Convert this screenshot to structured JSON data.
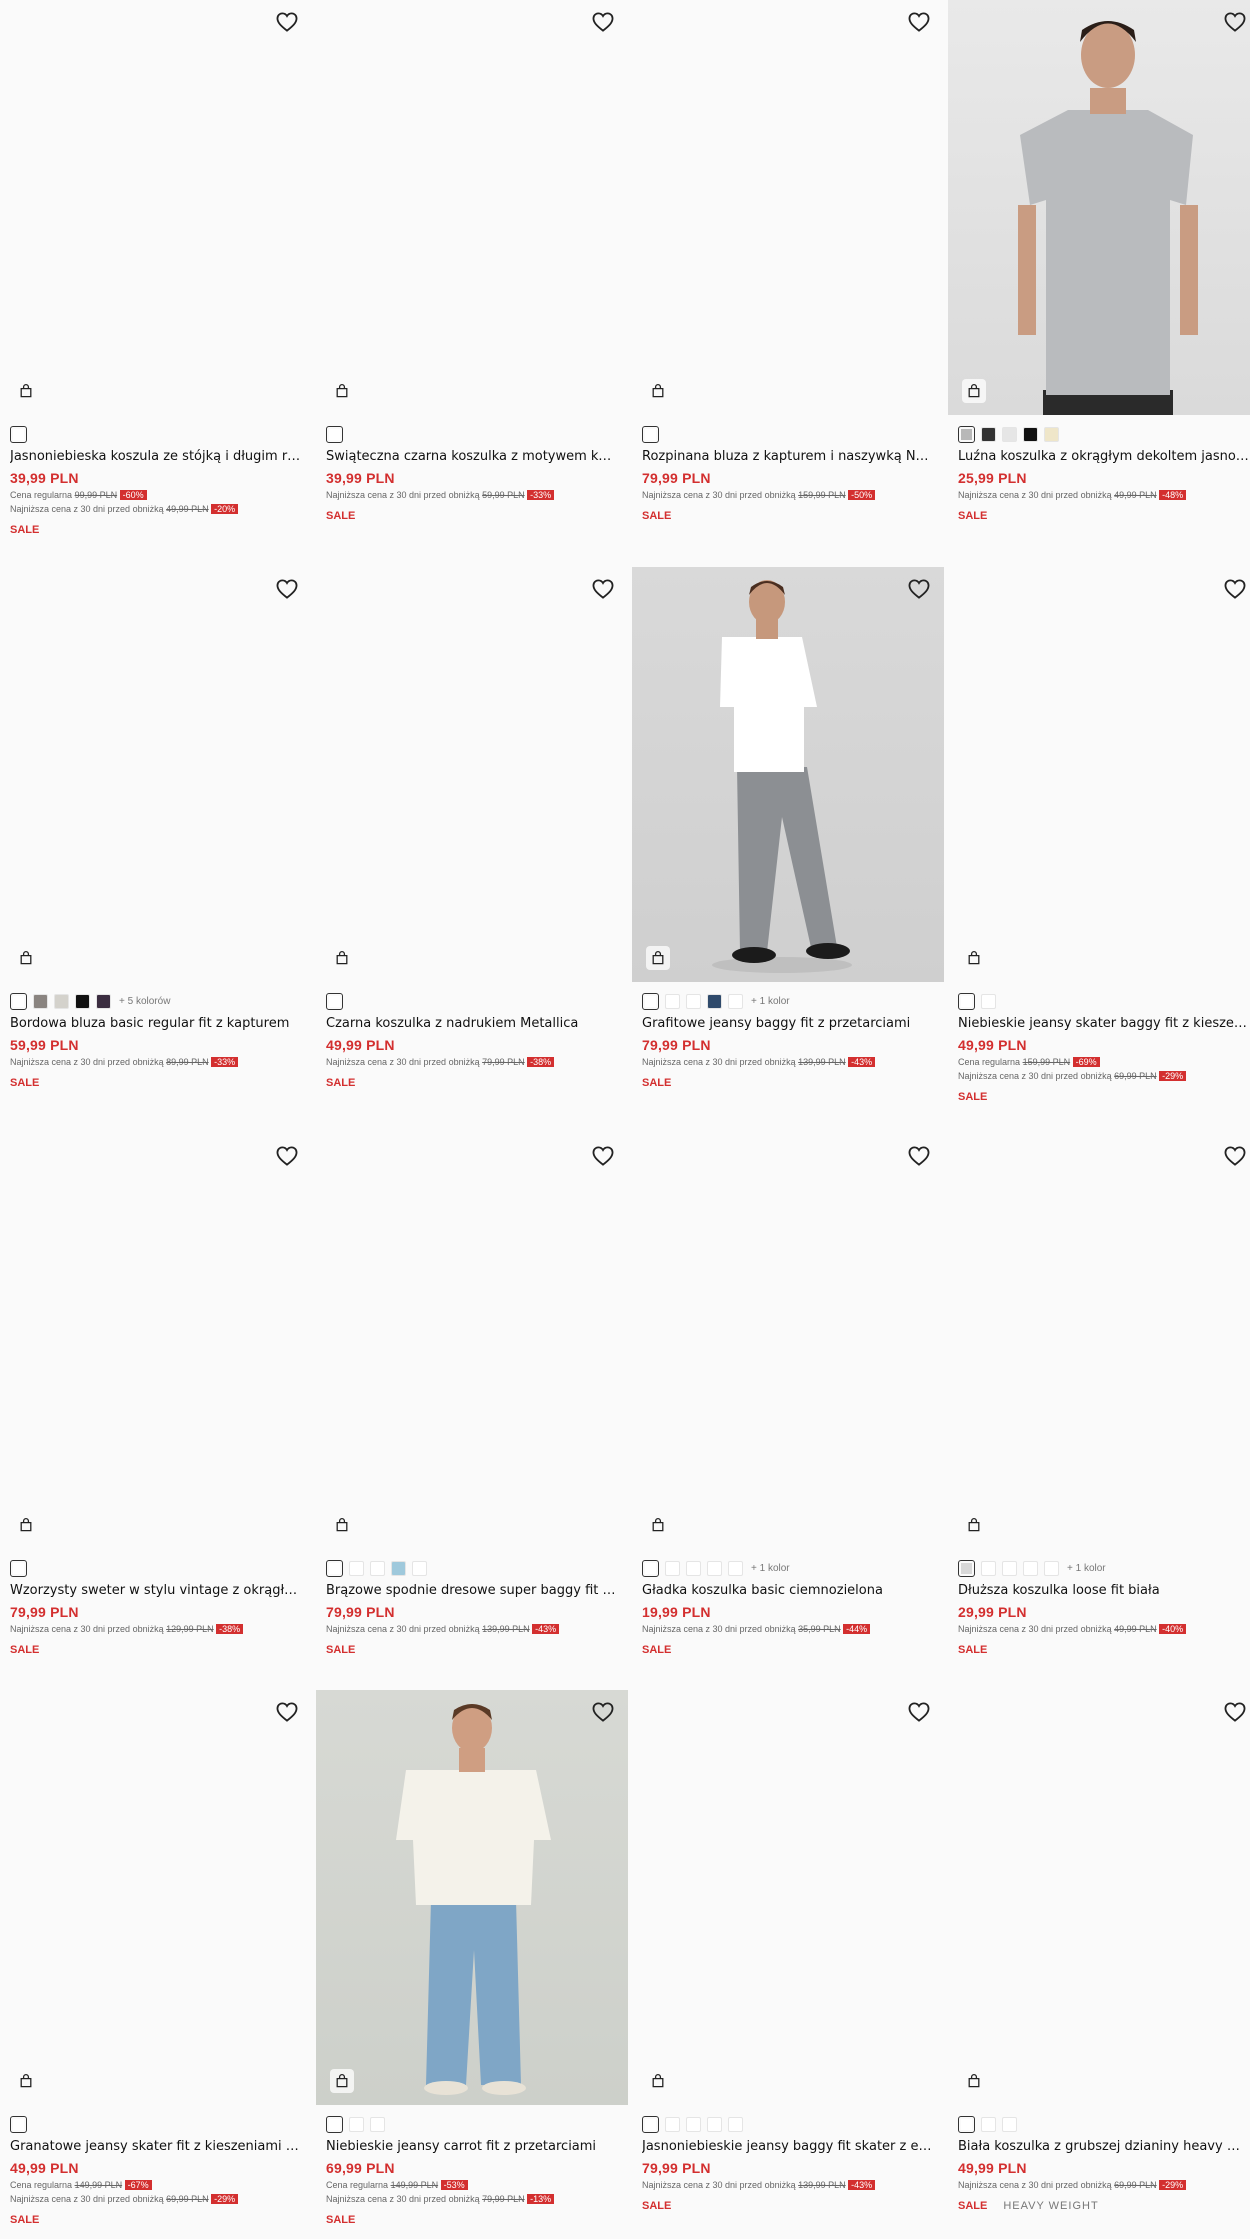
{
  "icons": {
    "wishlist": "heart-icon",
    "cart": "shopping-bag-icon"
  },
  "colors": {
    "price": "#d32f2f",
    "discount_bg": "#d32f2f",
    "background": "#fafafa"
  },
  "products": [
    {
      "name": "Jasnoniebieska koszula ze stójką i długim rękawem",
      "price": "39,99 PLN",
      "lines": [
        {
          "label": "Cena regularna",
          "old": "99,99 PLN",
          "disc": "-60%"
        },
        {
          "label": "Najniższa cena z 30 dni przed obniżką",
          "old": "49,99 PLN",
          "disc": "-20%"
        }
      ],
      "tags": [
        "SALE"
      ],
      "swatches": [
        {
          "color": "#ffffff",
          "selected": true
        }
      ],
      "more": ""
    },
    {
      "name": "Świąteczna czarna koszulka z motywem karmy",
      "price": "39,99 PLN",
      "lines": [
        {
          "label": "Najniższa cena z 30 dni przed obniżką",
          "old": "59,99 PLN",
          "disc": "-33%"
        }
      ],
      "tags": [
        "SALE"
      ],
      "swatches": [
        {
          "color": "#ffffff",
          "selected": true
        }
      ],
      "more": ""
    },
    {
      "name": "Rozpinana bluza z kapturem i naszywką NY granatowa",
      "price": "79,99 PLN",
      "lines": [
        {
          "label": "Najniższa cena z 30 dni przed obniżką",
          "old": "159,99 PLN",
          "disc": "-50%"
        }
      ],
      "tags": [
        "SALE"
      ],
      "swatches": [
        {
          "color": "#ffffff",
          "selected": true
        }
      ],
      "more": ""
    },
    {
      "name": "Luźna koszulka z okrągłym dekoltem jasnoszara melanż",
      "price": "25,99 PLN",
      "lines": [
        {
          "label": "Najniższa cena z 30 dni przed obniżką",
          "old": "49,99 PLN",
          "disc": "-48%"
        }
      ],
      "tags": [
        "SALE"
      ],
      "swatches": [
        {
          "color": "#b8b8b8",
          "selected": true
        },
        {
          "color": "#333333"
        },
        {
          "color": "#e6e6e6"
        },
        {
          "color": "#111111"
        },
        {
          "color": "#efe6c9"
        }
      ],
      "more": ""
    },
    {
      "name": "Bordowa bluza basic regular fit z kapturem",
      "price": "59,99 PLN",
      "lines": [
        {
          "label": "Najniższa cena z 30 dni przed obniżką",
          "old": "89,99 PLN",
          "disc": "-33%"
        }
      ],
      "tags": [
        "SALE"
      ],
      "swatches": [
        {
          "color": "#ffffff",
          "selected": true
        },
        {
          "color": "#8a8480"
        },
        {
          "color": "#d4d2cc"
        },
        {
          "color": "#111111"
        },
        {
          "color": "#3b2d40"
        }
      ],
      "more": "+ 5 kolorów"
    },
    {
      "name": "Czarna koszulka z nadrukiem Metallica",
      "price": "49,99 PLN",
      "lines": [
        {
          "label": "Najniższa cena z 30 dni przed obniżką",
          "old": "79,99 PLN",
          "disc": "-38%"
        }
      ],
      "tags": [
        "SALE"
      ],
      "swatches": [
        {
          "color": "#ffffff",
          "selected": true
        }
      ],
      "more": ""
    },
    {
      "name": "Grafitowe jeansy baggy fit z przetarciami",
      "price": "79,99 PLN",
      "lines": [
        {
          "label": "Najniższa cena z 30 dni przed obniżką",
          "old": "139,99 PLN",
          "disc": "-43%"
        }
      ],
      "tags": [
        "SALE"
      ],
      "swatches": [
        {
          "color": "#ffffff",
          "selected": true
        },
        {
          "color": "#ffffff"
        },
        {
          "color": "#ffffff"
        },
        {
          "color": "#2f4a6b"
        },
        {
          "color": "#ffffff"
        }
      ],
      "more": "+ 1 kolor"
    },
    {
      "name": "Niebieskie jeansy skater baggy fit z kieszeniami cargo",
      "price": "49,99 PLN",
      "lines": [
        {
          "label": "Cena regularna",
          "old": "159,99 PLN",
          "disc": "-69%"
        },
        {
          "label": "Najniższa cena z 30 dni przed obniżką",
          "old": "69,99 PLN",
          "disc": "-29%"
        }
      ],
      "tags": [
        "SALE"
      ],
      "swatches": [
        {
          "color": "#ffffff",
          "selected": true
        },
        {
          "color": "#ffffff"
        }
      ],
      "more": ""
    },
    {
      "name": "Wzorzysty sweter w stylu vintage z okrągłym dekoltem",
      "price": "79,99 PLN",
      "lines": [
        {
          "label": "Najniższa cena z 30 dni przed obniżką",
          "old": "129,99 PLN",
          "disc": "-38%"
        }
      ],
      "tags": [
        "SALE"
      ],
      "swatches": [
        {
          "color": "#ffffff",
          "selected": true
        }
      ],
      "more": ""
    },
    {
      "name": "Brązowe spodnie dresowe super baggy fit basic",
      "price": "79,99 PLN",
      "lines": [
        {
          "label": "Najniższa cena z 30 dni przed obniżką",
          "old": "139,99 PLN",
          "disc": "-43%"
        }
      ],
      "tags": [
        "SALE"
      ],
      "swatches": [
        {
          "color": "#ffffff",
          "selected": true
        },
        {
          "color": "#ffffff"
        },
        {
          "color": "#ffffff"
        },
        {
          "color": "#9fc9dc"
        },
        {
          "color": "#ffffff"
        }
      ],
      "more": ""
    },
    {
      "name": "Gładka koszulka basic ciemnozielona",
      "price": "19,99 PLN",
      "lines": [
        {
          "label": "Najniższa cena z 30 dni przed obniżką",
          "old": "35,99 PLN",
          "disc": "-44%"
        }
      ],
      "tags": [
        "SALE"
      ],
      "swatches": [
        {
          "color": "#ffffff",
          "selected": true
        },
        {
          "color": "#ffffff"
        },
        {
          "color": "#ffffff"
        },
        {
          "color": "#ffffff"
        },
        {
          "color": "#ffffff"
        }
      ],
      "more": "+ 1 kolor"
    },
    {
      "name": "Dłuższa koszulka loose fit biała",
      "price": "29,99 PLN",
      "lines": [
        {
          "label": "Najniższa cena z 30 dni przed obniżką",
          "old": "49,99 PLN",
          "disc": "-40%"
        }
      ],
      "tags": [
        "SALE"
      ],
      "swatches": [
        {
          "color": "#d8d8d8",
          "selected": true
        },
        {
          "color": "#ffffff"
        },
        {
          "color": "#ffffff"
        },
        {
          "color": "#ffffff"
        },
        {
          "color": "#ffffff"
        }
      ],
      "more": "+ 1 kolor"
    },
    {
      "name": "Granatowe jeansy skater fit z kieszeniami cargo",
      "price": "49,99 PLN",
      "lines": [
        {
          "label": "Cena regularna",
          "old": "149,99 PLN",
          "disc": "-67%"
        },
        {
          "label": "Najniższa cena z 30 dni przed obniżką",
          "old": "69,99 PLN",
          "disc": "-29%"
        }
      ],
      "tags": [
        "SALE"
      ],
      "swatches": [
        {
          "color": "#ffffff",
          "selected": true
        }
      ],
      "more": ""
    },
    {
      "name": "Niebieskie jeansy carrot fit z przetarciami",
      "price": "69,99 PLN",
      "lines": [
        {
          "label": "Cena regularna",
          "old": "149,99 PLN",
          "disc": "-53%"
        },
        {
          "label": "Najniższa cena z 30 dni przed obniżką",
          "old": "79,99 PLN",
          "disc": "-13%"
        }
      ],
      "tags": [
        "SALE"
      ],
      "swatches": [
        {
          "color": "#ffffff",
          "selected": true
        },
        {
          "color": "#ffffff"
        },
        {
          "color": "#ffffff"
        }
      ],
      "more": ""
    },
    {
      "name": "Jasnoniebieskie jeansy baggy fit skater z efektem sprania",
      "price": "79,99 PLN",
      "lines": [
        {
          "label": "Najniższa cena z 30 dni przed obniżką",
          "old": "139,99 PLN",
          "disc": "-43%"
        }
      ],
      "tags": [
        "SALE"
      ],
      "swatches": [
        {
          "color": "#ffffff",
          "selected": true
        },
        {
          "color": "#ffffff"
        },
        {
          "color": "#ffffff"
        },
        {
          "color": "#ffffff"
        },
        {
          "color": "#ffffff"
        }
      ],
      "more": ""
    },
    {
      "name": "Biała koszulka z grubszej dzianiny heavy weight",
      "price": "49,99 PLN",
      "lines": [
        {
          "label": "Najniższa cena z 30 dni przed obniżką",
          "old": "69,99 PLN",
          "disc": "-29%"
        }
      ],
      "tags": [
        "SALE",
        "HEAVY WEIGHT"
      ],
      "swatches": [
        {
          "color": "#ffffff",
          "selected": true
        },
        {
          "color": "#ffffff"
        },
        {
          "color": "#ffffff"
        }
      ],
      "more": ""
    }
  ]
}
